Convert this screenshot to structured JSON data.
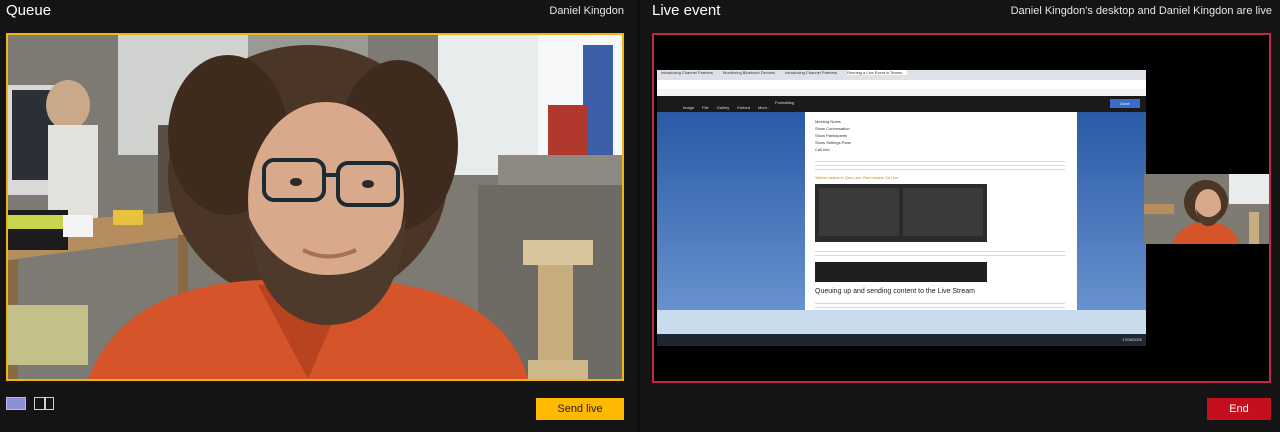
{
  "queue": {
    "title": "Queue",
    "presenter": "Daniel Kingdon",
    "send_live_label": "Send live",
    "layout_options": [
      "single-source-layout",
      "side-by-side-layout"
    ],
    "accent_color": "#ffb900"
  },
  "live_event": {
    "title": "Live event",
    "status": "Daniel Kingdon's desktop and Daniel Kingdon are live",
    "end_label": "End",
    "accent_color": "#c4264a",
    "shared_doc": {
      "tabs": [
        "Introducing Channel Partners",
        "Monitoring Bluetooth Devices",
        "Introducing Channel Partners",
        "Running a Live Event in Teams"
      ],
      "bullets": [
        "Meeting Notes",
        "Show Conversation",
        "Show Participants",
        "Show Settings Pane",
        "Call Info"
      ],
      "highlight": "Yellow means in Que Live, Red means On Live",
      "heading": "Queuing up and sending content to the Live Stream",
      "toolbar_items": [
        "Image",
        "File",
        "Gallery",
        "Embed",
        "More..."
      ],
      "format_label": "Formatting",
      "done_label": "Done",
      "tray_date": "17/06/2020"
    }
  }
}
